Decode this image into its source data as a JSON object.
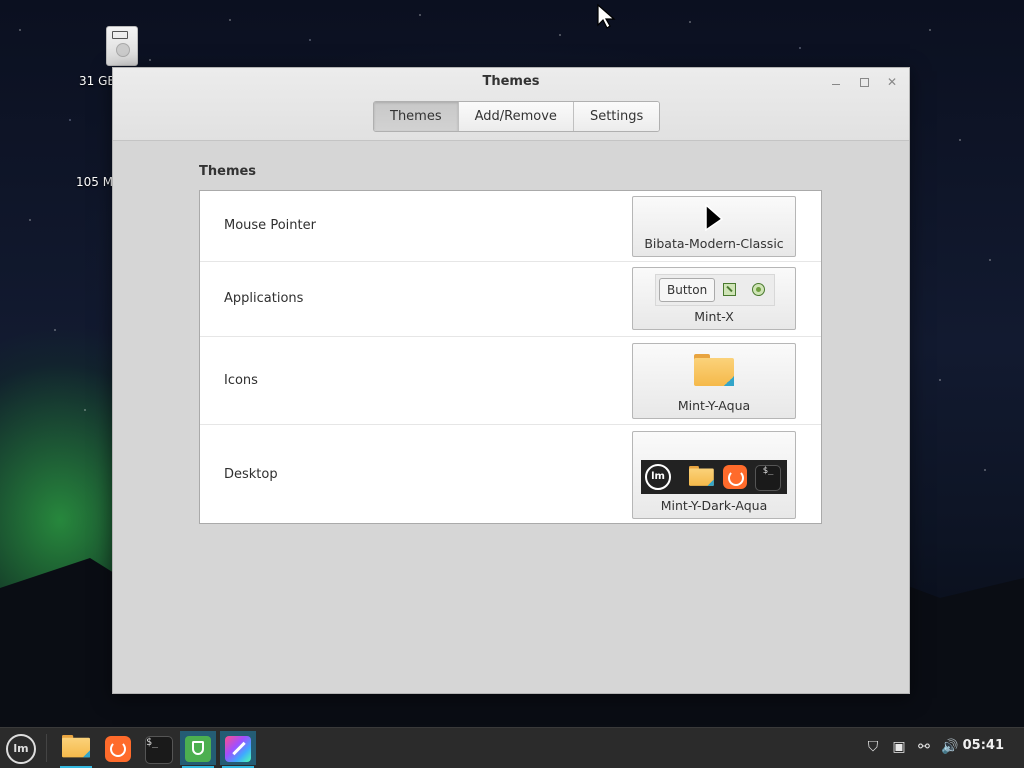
{
  "desktop": {
    "icons": [
      {
        "label": "31 GB"
      },
      {
        "label": "105 M"
      }
    ]
  },
  "window": {
    "title": "Themes",
    "tabs": [
      {
        "label": "Themes",
        "active": true
      },
      {
        "label": "Add/Remove",
        "active": false
      },
      {
        "label": "Settings",
        "active": false
      }
    ],
    "section_title": "Themes",
    "rows": [
      {
        "label": "Mouse Pointer",
        "value": "Bibata-Modern-Classic"
      },
      {
        "label": "Applications",
        "value": "Mint-X",
        "preview_button": "Button"
      },
      {
        "label": "Icons",
        "value": "Mint-Y-Aqua"
      },
      {
        "label": "Desktop",
        "value": "Mint-Y-Dark-Aqua"
      }
    ]
  },
  "taskbar": {
    "clock": "05:41",
    "items": [
      "menu",
      "files",
      "firefox",
      "terminal",
      "security",
      "theme-tool"
    ]
  },
  "colors": {
    "accent": "#35b9e0",
    "window_bg": "#d6d6d6",
    "panel_bg": "#ffffff",
    "taskbar_bg": "#2b2b2b"
  }
}
